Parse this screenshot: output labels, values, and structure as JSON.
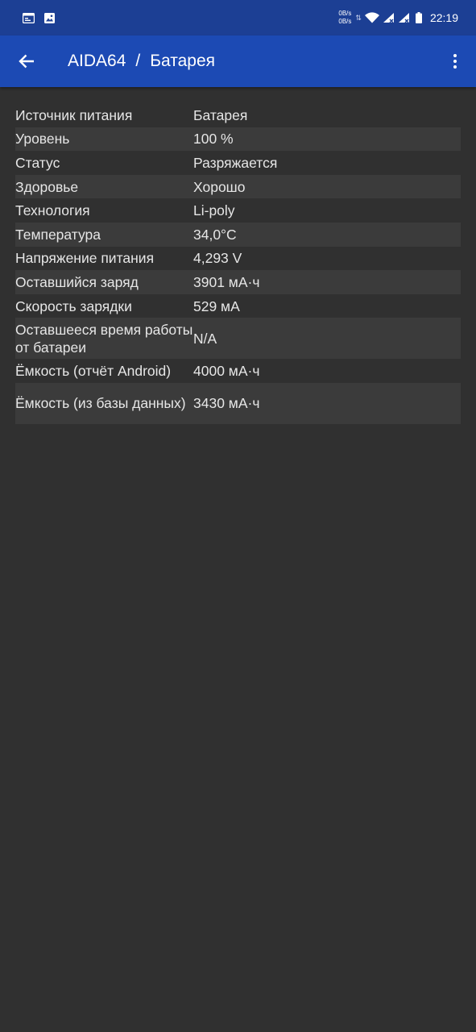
{
  "status_bar": {
    "net_up": "0B/s",
    "net_down": "0B/s",
    "time": "22:19"
  },
  "app_bar": {
    "app_name": "AIDA64",
    "separator": "/",
    "section": "Батарея"
  },
  "battery": {
    "rows": [
      {
        "label": "Источник питания",
        "value": "Батарея"
      },
      {
        "label": "Уровень",
        "value": "100 %"
      },
      {
        "label": "Статус",
        "value": "Разряжается"
      },
      {
        "label": "Здоровье",
        "value": "Хорошо"
      },
      {
        "label": "Технология",
        "value": "Li-poly"
      },
      {
        "label": "Температура",
        "value": "34,0°C"
      },
      {
        "label": "Напряжение питания",
        "value": "4,293 V"
      },
      {
        "label": "Оставшийся заряд",
        "value": "3901 мА·ч"
      },
      {
        "label": "Скорость зарядки",
        "value": "529 мА"
      },
      {
        "label": "Оставшееся время работы от батареи",
        "value": "N/A"
      },
      {
        "label": "Ёмкость (отчёт Android)",
        "value": "4000 мА·ч"
      },
      {
        "label": "Ёмкость (из базы данных)",
        "value": "3430 мА·ч"
      }
    ]
  }
}
